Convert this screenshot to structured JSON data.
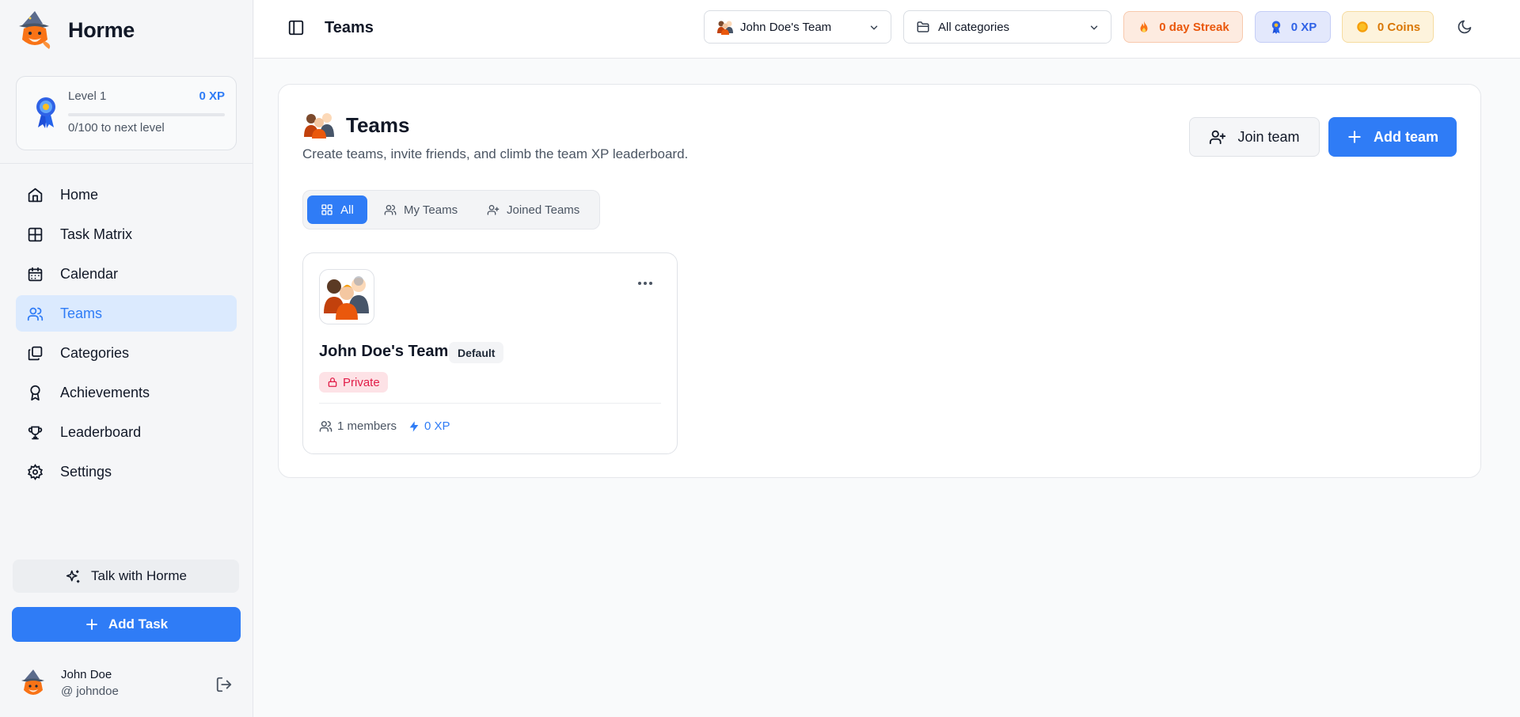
{
  "app": {
    "name": "Horme"
  },
  "level": {
    "label": "Level 1",
    "xp": "0 XP",
    "next": "0/100 to next level",
    "progress": 0
  },
  "nav": [
    {
      "label": "Home",
      "icon": "home-icon"
    },
    {
      "label": "Task Matrix",
      "icon": "grid-icon"
    },
    {
      "label": "Calendar",
      "icon": "calendar-icon"
    },
    {
      "label": "Teams",
      "icon": "users-icon",
      "active": true
    },
    {
      "label": "Categories",
      "icon": "layers-icon"
    },
    {
      "label": "Achievements",
      "icon": "award-icon"
    },
    {
      "label": "Leaderboard",
      "icon": "trophy-icon"
    },
    {
      "label": "Settings",
      "icon": "gear-icon"
    }
  ],
  "sidebar_actions": {
    "talk": "Talk with Horme",
    "add_task": "Add Task"
  },
  "user": {
    "name": "John Doe",
    "handle": "@ johndoe"
  },
  "topbar": {
    "title": "Teams",
    "team_select": "John Doe's Team",
    "category_select": "All categories",
    "streak": "0 day Streak",
    "xp": "0 XP",
    "coins": "0 Coins"
  },
  "page": {
    "title": "Teams",
    "subtitle": "Create teams, invite friends, and climb the team XP leaderboard.",
    "join_label": "Join team",
    "add_label": "Add team",
    "tabs": {
      "all": "All",
      "my": "My Teams",
      "joined": "Joined Teams"
    }
  },
  "teams": [
    {
      "name": "John Doe's Team",
      "default_badge": "Default",
      "privacy": "Private",
      "members": "1 members",
      "xp": "0 XP"
    }
  ],
  "colors": {
    "accent": "#2f7cf6",
    "streak": "#ea580c",
    "coins": "#d97706",
    "private": "#e11d48"
  }
}
